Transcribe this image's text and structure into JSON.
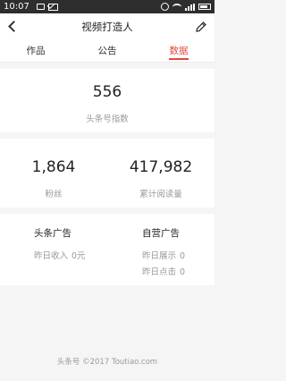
{
  "status_bar": {
    "time": "10:07",
    "icons": [
      "screen-icon",
      "mail-icon",
      "alarm-icon",
      "wifi-icon",
      "signal-icon",
      "battery-icon"
    ]
  },
  "header": {
    "title": "视频打造人",
    "back_icon": "chevron-left-icon",
    "edit_icon": "edit-icon"
  },
  "tabs": [
    {
      "label": "作品",
      "active": false
    },
    {
      "label": "公告",
      "active": false
    },
    {
      "label": "数据",
      "active": true
    }
  ],
  "index_card": {
    "value": "556",
    "label": "头条号指数"
  },
  "stats": [
    {
      "value": "1,864",
      "label": "粉丝"
    },
    {
      "value": "417,982",
      "label": "累计阅读量"
    }
  ],
  "ads": {
    "toutiao": {
      "title": "头条广告",
      "lines": [
        {
          "label": "昨日收入",
          "value": "0元"
        }
      ]
    },
    "self": {
      "title": "自营广告",
      "lines": [
        {
          "label": "昨日展示",
          "value": "0"
        },
        {
          "label": "昨日点击",
          "value": "0"
        }
      ]
    }
  },
  "footer": "头条号 ©2017 Toutiao.com",
  "colors": {
    "accent": "#e2483d",
    "statusbar": "#2e2e2e",
    "background": "#f5f5f5"
  }
}
